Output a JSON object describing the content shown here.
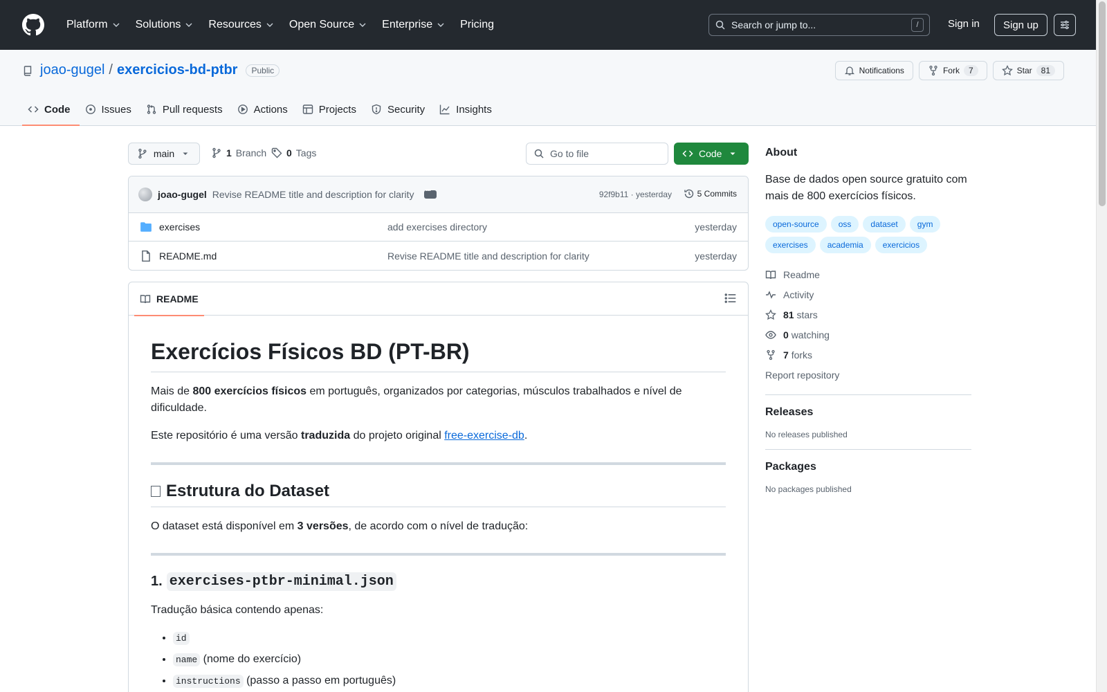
{
  "topnav": {
    "items": [
      "Platform",
      "Solutions",
      "Resources",
      "Open Source",
      "Enterprise",
      "Pricing"
    ],
    "search_placeholder": "Search or jump to...",
    "search_shortcut": "/",
    "signin": "Sign in",
    "signup": "Sign up"
  },
  "repo": {
    "owner": "joao-gugel",
    "separator": "/",
    "name": "exercicios-bd-ptbr",
    "visibility": "Public",
    "notifications_label": "Notifications",
    "fork_label": "Fork",
    "fork_count": "7",
    "star_label": "Star",
    "star_count": "81",
    "tabs": [
      "Code",
      "Issues",
      "Pull requests",
      "Actions",
      "Projects",
      "Security",
      "Insights"
    ]
  },
  "branch": {
    "current": "main",
    "branch_count": "1",
    "branch_label": "Branch",
    "tag_count": "0",
    "tag_label": "Tags",
    "goto_placeholder": "Go to file",
    "code_button": "Code"
  },
  "commit": {
    "author": "joao-gugel",
    "message": "Revise README title and description for clarity",
    "meta": "92f9b11 · yesterday",
    "commits_label": "5 Commits"
  },
  "files": [
    {
      "type": "folder",
      "name": "exercises",
      "message": "add exercises directory",
      "date": "yesterday"
    },
    {
      "type": "file",
      "name": "README.md",
      "message": "Revise README title and description for clarity",
      "date": "yesterday"
    }
  ],
  "readme": {
    "tab": "README",
    "title": "Exercícios Físicos BD (PT-BR)",
    "p1_a": "Mais de ",
    "p1_b": "800 exercícios físicos",
    "p1_c": " em português, organizados por categorias, músculos trabalhados e nível de dificuldade.",
    "p2_a": "Este repositório é uma versão ",
    "p2_b": "traduzida",
    "p2_c": " do projeto original ",
    "p2_link": "free-exercise-db",
    "p2_d": ".",
    "h2": "Estrutura do Dataset",
    "p3_a": "O dataset está disponível em ",
    "p3_b": "3 versões",
    "p3_c": ", de acordo com o nível de tradução:",
    "h3_num": "1.",
    "h3_code": "exercises-ptbr-minimal.json",
    "p4": "Tradução básica contendo apenas:",
    "list": [
      {
        "code": "id",
        "text": ""
      },
      {
        "code": "name",
        "text": " (nome do exercício)"
      },
      {
        "code": "instructions",
        "text": " (passo a passo em português)"
      }
    ]
  },
  "sidebar": {
    "about_title": "About",
    "description": "Base de dados open source gratuito com mais de 800 exercícios físicos.",
    "topics": [
      "open-source",
      "oss",
      "dataset",
      "gym",
      "exercises",
      "academia",
      "exercicios"
    ],
    "readme_link": "Readme",
    "activity_link": "Activity",
    "stars_count": "81",
    "stars_label": "stars",
    "watching_count": "0",
    "watching_label": "watching",
    "forks_count": "7",
    "forks_label": "forks",
    "report": "Report repository",
    "releases_title": "Releases",
    "releases_text": "No releases published",
    "packages_title": "Packages",
    "packages_text": "No packages published"
  }
}
